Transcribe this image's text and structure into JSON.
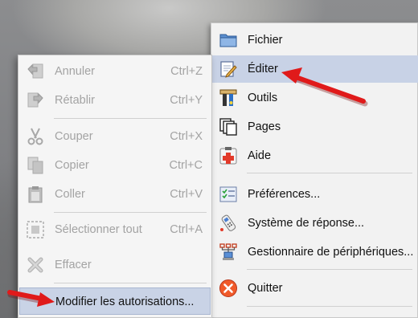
{
  "main_menu": {
    "items": [
      {
        "label": "Fichier",
        "icon": "folder-icon"
      },
      {
        "label": "Éditer",
        "icon": "edit-icon"
      },
      {
        "label": "Outils",
        "icon": "tools-icon"
      },
      {
        "label": "Pages",
        "icon": "pages-icon"
      },
      {
        "label": "Aide",
        "icon": "help-icon"
      },
      {
        "label": "Préférences...",
        "icon": "preferences-icon"
      },
      {
        "label": "Système de réponse...",
        "icon": "response-system-icon"
      },
      {
        "label": "Gestionnaire de périphériques...",
        "icon": "device-manager-icon"
      },
      {
        "label": "Quitter",
        "icon": "quit-icon"
      }
    ],
    "highlighted": "Éditer"
  },
  "edit_submenu": {
    "items": [
      {
        "label": "Annuler",
        "shortcut": "Ctrl+Z",
        "icon": "undo-icon",
        "enabled": false
      },
      {
        "label": "Rétablir",
        "shortcut": "Ctrl+Y",
        "icon": "redo-icon",
        "enabled": false
      },
      {
        "label": "Couper",
        "shortcut": "Ctrl+X",
        "icon": "scissors-icon",
        "enabled": false
      },
      {
        "label": "Copier",
        "shortcut": "Ctrl+C",
        "icon": "copy-icon",
        "enabled": false
      },
      {
        "label": "Coller",
        "shortcut": "Ctrl+V",
        "icon": "paste-icon",
        "enabled": false
      },
      {
        "label": "Sélectionner tout",
        "shortcut": "Ctrl+A",
        "icon": "select-all-icon",
        "enabled": false
      },
      {
        "label": "Effacer",
        "shortcut": "",
        "icon": "delete-icon",
        "enabled": false
      },
      {
        "label": "Modifier les autorisations...",
        "shortcut": "",
        "icon": "",
        "enabled": true
      }
    ],
    "highlighted": "Modifier les autorisations..."
  },
  "colors": {
    "highlight": "#c8d2e6",
    "arrow": "#e01a1a",
    "disabled_text": "#a3a3a3"
  }
}
